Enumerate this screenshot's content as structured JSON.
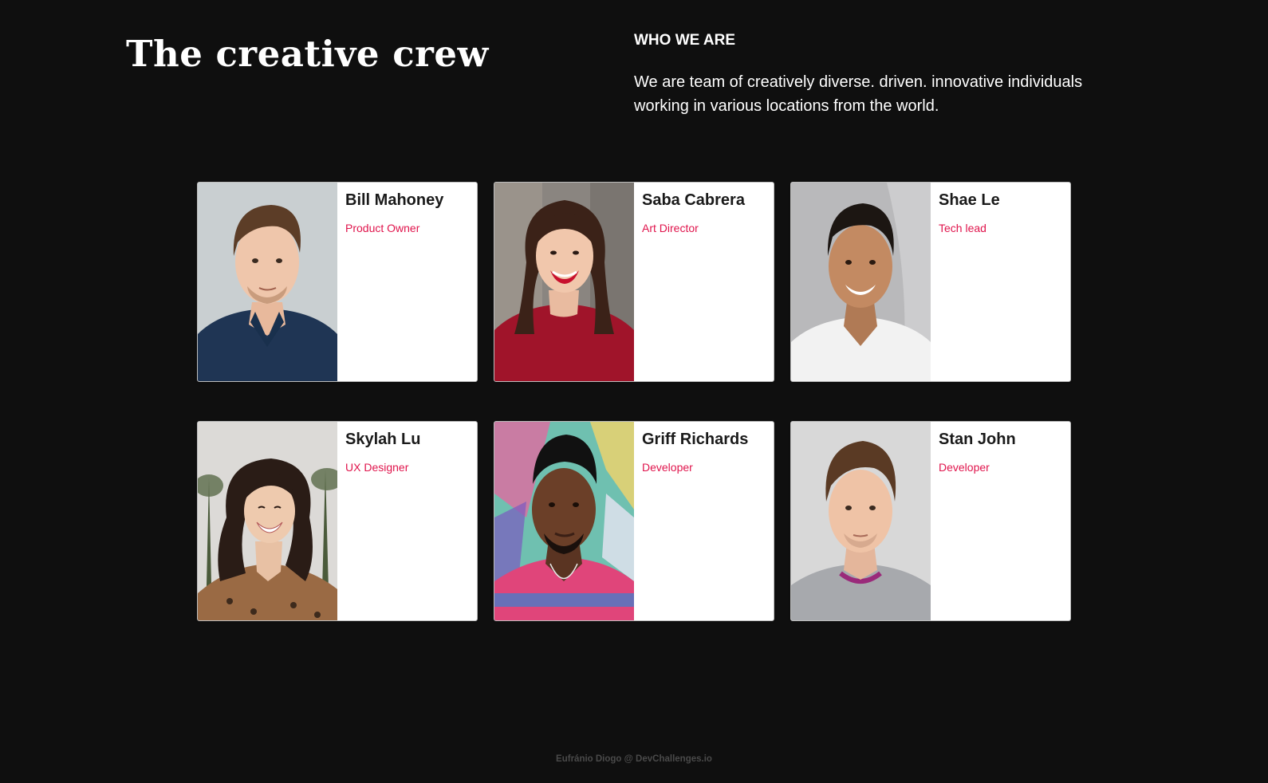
{
  "header": {
    "title": "The creative crew",
    "who_heading": "WHO WE ARE",
    "who_description": "We are team of creatively diverse. driven. innovative individuals working in various locations from the world."
  },
  "members": [
    {
      "name": "Bill Mahoney",
      "role": "Product Owner",
      "photo_icon": "portrait-man-navy-polo"
    },
    {
      "name": "Saba Cabrera",
      "role": "Art Director",
      "photo_icon": "portrait-woman-red-top"
    },
    {
      "name": "Shae Le",
      "role": "Tech lead",
      "photo_icon": "portrait-man-white-tee"
    },
    {
      "name": "Skylah Lu",
      "role": "UX Designer",
      "photo_icon": "portrait-woman-leopard-top"
    },
    {
      "name": "Griff Richards",
      "role": "Developer",
      "photo_icon": "portrait-man-pink-tee"
    },
    {
      "name": "Stan John",
      "role": "Developer",
      "photo_icon": "portrait-man-grey-sweater"
    }
  ],
  "footer": {
    "credit": "Eufránio Diogo @ DevChallenges.io"
  },
  "colors": {
    "background": "#0f0f0f",
    "card": "#ffffff",
    "role_accent": "#e0144c",
    "name_text": "#1a1a1a"
  }
}
